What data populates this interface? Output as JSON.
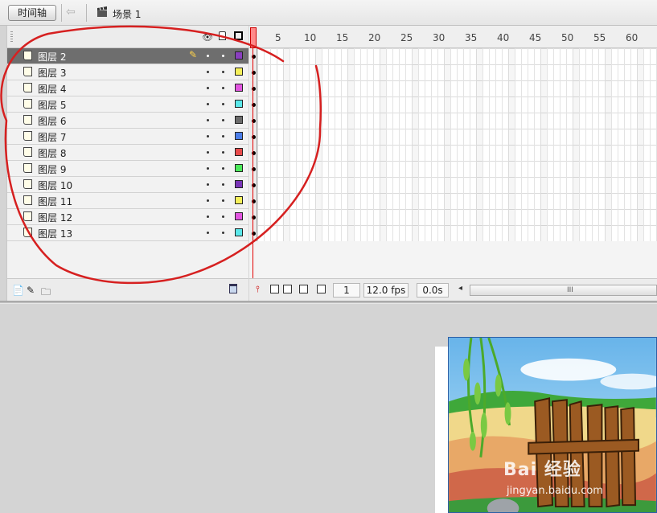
{
  "toolbar": {
    "timeline_button": "时间轴",
    "scene_label": "场景 1"
  },
  "layers": [
    {
      "name": "图层 2",
      "color": "#8a3fbf",
      "selected": true
    },
    {
      "name": "图层 3",
      "color": "#f5f05a"
    },
    {
      "name": "图层 4",
      "color": "#e255e0"
    },
    {
      "name": "图层 5",
      "color": "#5ae8ea"
    },
    {
      "name": "图层 6",
      "color": "#6b6b6b"
    },
    {
      "name": "图层 7",
      "color": "#4b7de8"
    },
    {
      "name": "图层 8",
      "color": "#e84b4b"
    },
    {
      "name": "图层 9",
      "color": "#4bea5a"
    },
    {
      "name": "图层 10",
      "color": "#7a35b8"
    },
    {
      "name": "图层 11",
      "color": "#f5f05a"
    },
    {
      "name": "图层 12",
      "color": "#e255e0"
    },
    {
      "name": "图层 13",
      "color": "#5ae8ea"
    }
  ],
  "ruler": {
    "ticks": [
      "5",
      "10",
      "15",
      "20",
      "25",
      "30",
      "35",
      "40",
      "45",
      "50",
      "55",
      "60"
    ]
  },
  "timeline_footer": {
    "current_frame": "1",
    "frame_rate": "12.0 fps",
    "elapsed_time": "0.0s"
  },
  "watermark": {
    "brand": "Bai 经验",
    "url": "jingyan.baidu.com"
  },
  "annotation_color": "#d62020"
}
